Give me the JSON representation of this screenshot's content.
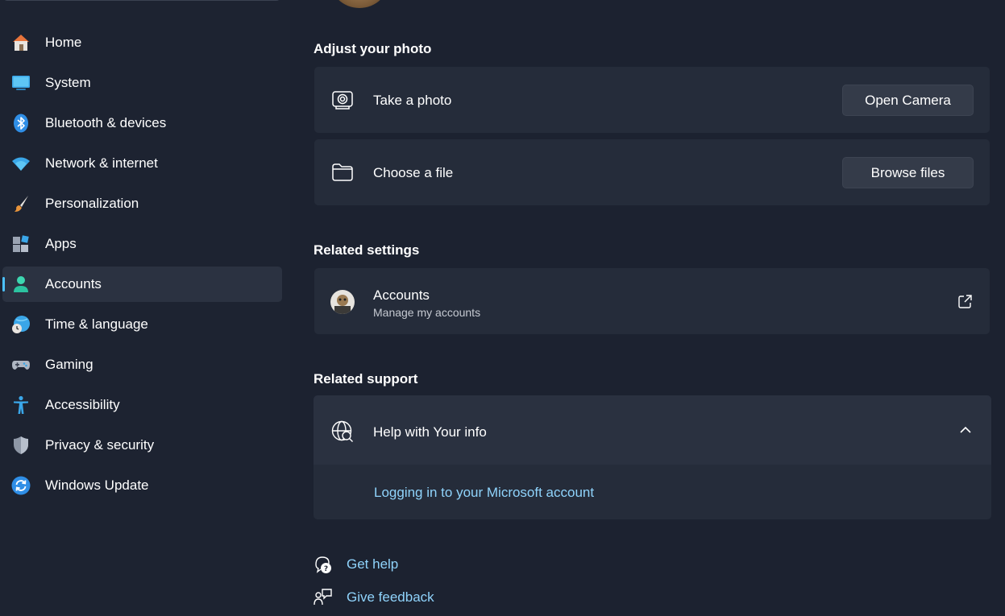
{
  "sidebar": {
    "items": [
      {
        "label": "Home",
        "icon": "home-icon"
      },
      {
        "label": "System",
        "icon": "system-icon"
      },
      {
        "label": "Bluetooth & devices",
        "icon": "bluetooth-icon"
      },
      {
        "label": "Network & internet",
        "icon": "wifi-icon"
      },
      {
        "label": "Personalization",
        "icon": "brush-icon"
      },
      {
        "label": "Apps",
        "icon": "apps-icon"
      },
      {
        "label": "Accounts",
        "icon": "accounts-icon",
        "selected": true
      },
      {
        "label": "Time & language",
        "icon": "time-language-icon"
      },
      {
        "label": "Gaming",
        "icon": "gamepad-icon"
      },
      {
        "label": "Accessibility",
        "icon": "accessibility-icon"
      },
      {
        "label": "Privacy & security",
        "icon": "shield-icon"
      },
      {
        "label": "Windows Update",
        "icon": "update-icon"
      }
    ]
  },
  "main": {
    "adjust_photo": {
      "title": "Adjust your photo",
      "take_photo": {
        "label": "Take a photo",
        "button": "Open Camera"
      },
      "choose_file": {
        "label": "Choose a file",
        "button": "Browse files"
      }
    },
    "related_settings": {
      "title": "Related settings",
      "accounts": {
        "label": "Accounts",
        "sublabel": "Manage my accounts"
      }
    },
    "related_support": {
      "title": "Related support",
      "help": {
        "label": "Help with Your info",
        "link": "Logging in to your Microsoft account"
      }
    },
    "footer": {
      "get_help": "Get help",
      "give_feedback": "Give feedback"
    }
  },
  "colors": {
    "background": "#1c2230",
    "card": "#252c3a",
    "accent": "#4cc2ff",
    "link": "#8fd3fb"
  }
}
